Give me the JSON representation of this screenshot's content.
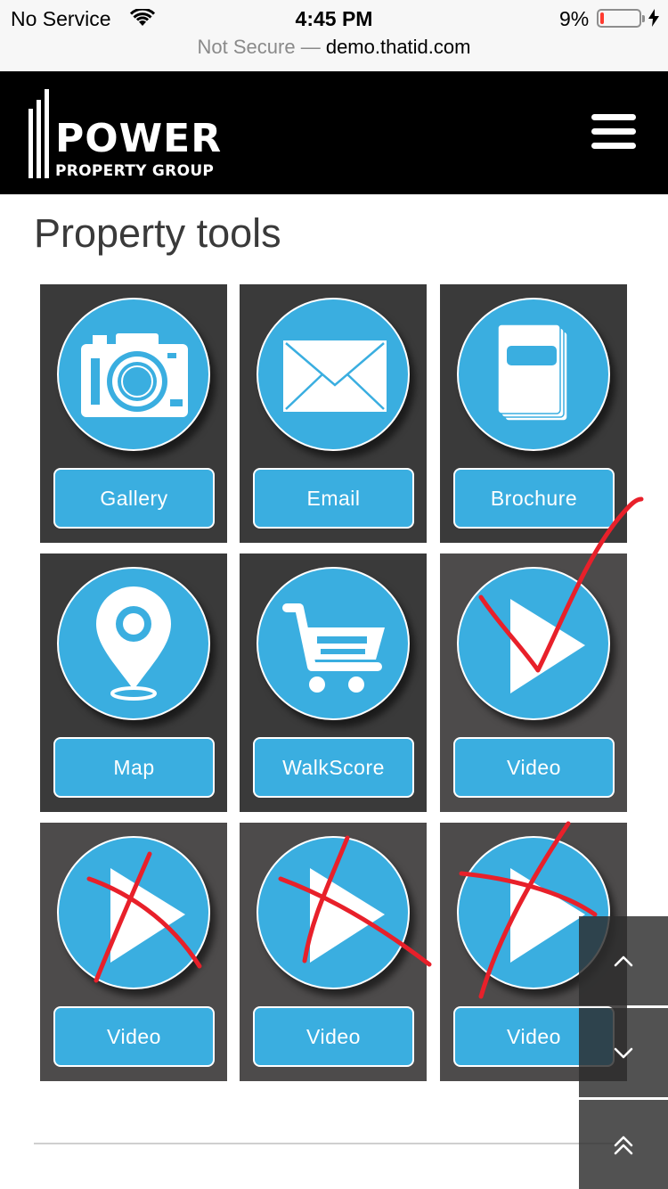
{
  "status_bar": {
    "carrier": "No Service",
    "time": "4:45 PM",
    "battery": "9%",
    "battery_level": 0.09
  },
  "url_bar": {
    "security": "Not Secure",
    "separator": "—",
    "domain": "demo.thatid.com"
  },
  "header": {
    "logo_word": "POWER",
    "logo_sub": "PROPERTY GROUP"
  },
  "page": {
    "title": "Property tools"
  },
  "tools": [
    {
      "label": "Gallery",
      "icon": "camera-icon"
    },
    {
      "label": "Email",
      "icon": "envelope-icon"
    },
    {
      "label": "Brochure",
      "icon": "brochure-icon"
    },
    {
      "label": "Map",
      "icon": "map-pin-icon"
    },
    {
      "label": "WalkScore",
      "icon": "shopping-cart-icon"
    },
    {
      "label": "Video",
      "icon": "play-icon",
      "annotation": "check"
    },
    {
      "label": "Video",
      "icon": "play-icon",
      "annotation": "cross"
    },
    {
      "label": "Video",
      "icon": "play-icon",
      "annotation": "cross"
    },
    {
      "label": "Video",
      "icon": "play-icon",
      "annotation": "cross"
    }
  ],
  "scroll_controls": [
    {
      "icon": "chevron-up-icon"
    },
    {
      "icon": "chevron-down-icon"
    },
    {
      "icon": "double-chevron-up-icon"
    }
  ],
  "colors": {
    "accent": "#3aaee0",
    "tile": "#3a3a3a",
    "header": "#000000",
    "annotation": "#e8202a"
  }
}
